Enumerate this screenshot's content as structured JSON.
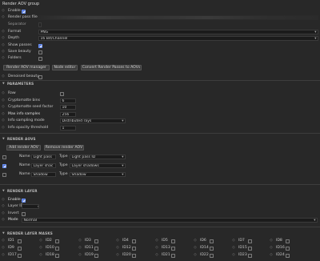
{
  "header": {
    "title": "Render AOV group"
  },
  "top": {
    "enable_label": "Enable",
    "render_pass_file_label": "Render pass file",
    "separator_label": "Separator",
    "format_label": "Format",
    "format_value": "PNG",
    "depth_label": "Depth",
    "depth_value": "16 Bit/Channel",
    "show_passes_label": "Show passes",
    "save_beauty_label": "Save beauty",
    "folders_label": "Folders"
  },
  "buttons": {
    "render_aov_manager": "Render AOV manager",
    "node_editor": "Node editor",
    "convert_render_passes": "Convert Render Passes to AOVs"
  },
  "denoised_beauty_label": "Denoised beauty",
  "parameters": {
    "section_title": "PARAMETERS",
    "raw_label": "Raw",
    "crypto_bins_label": "Cryptomatte bins",
    "crypto_bins_value": "6",
    "crypto_seed_label": "Cryptomatte seed factor",
    "crypto_seed_value": "10",
    "max_info_label": "Max info samples",
    "max_info_value": "256",
    "info_mode_label": "Info sampling mode",
    "info_mode_value": "Distributed rays",
    "info_opacity_label": "Info opacity threshold",
    "info_opacity_value": "1"
  },
  "render_aovs": {
    "section_title": "RENDER AOVS",
    "add_button": "Add render AOV",
    "remove_button": "Remove render AOV",
    "name_label": "Name",
    "type_label": "Type",
    "rows": [
      {
        "name": "Light pass",
        "type": "Light pass ID",
        "checked": false
      },
      {
        "name": "Layer shac",
        "type": "Layer shadows",
        "checked": true
      },
      {
        "name": "Shadow",
        "type": "Shadow",
        "checked": false
      }
    ]
  },
  "render_layer": {
    "section_title": "RENDER LAYER",
    "enable_label": "Enable",
    "layer_id_label": "Layer ID",
    "layer_id_value": "4",
    "invert_label": "Invert",
    "mode_label": "Mode",
    "mode_value": "Normal"
  },
  "layer_mask": {
    "section_title": "RENDER LAYER MASKS",
    "ids": [
      [
        "ID1",
        "ID2",
        "ID3",
        "ID4",
        "ID5",
        "ID6",
        "ID7",
        "ID8"
      ],
      [
        "ID9",
        "ID10",
        "ID11",
        "ID12",
        "ID13",
        "ID14",
        "ID15",
        "ID16"
      ],
      [
        "ID17",
        "ID18",
        "ID19",
        "ID20",
        "ID21",
        "ID22",
        "ID23",
        "ID24"
      ]
    ]
  },
  "colors": {
    "accent": "#4a6fd6",
    "background": "#282828",
    "field": "#1b1b1b"
  }
}
